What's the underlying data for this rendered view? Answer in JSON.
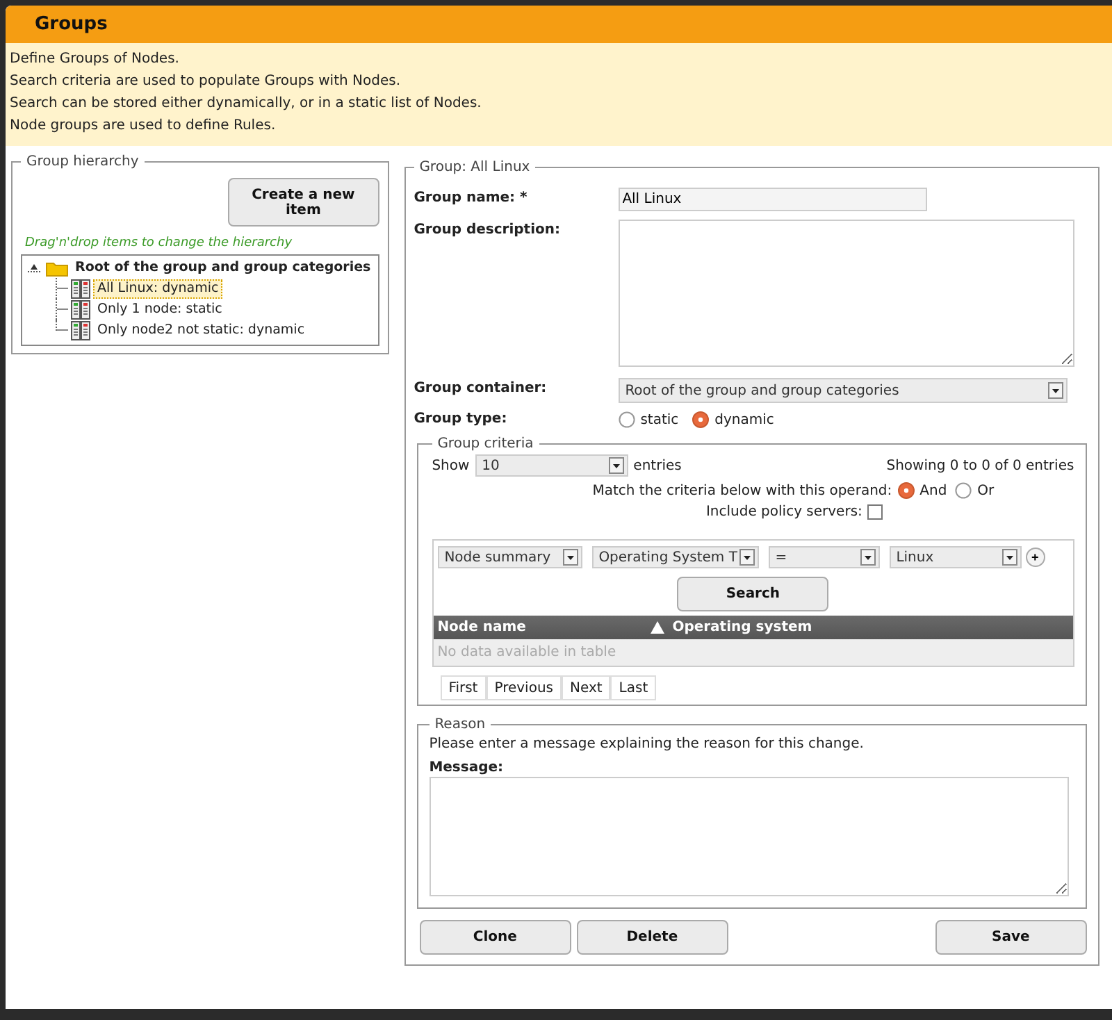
{
  "header": {
    "title": "Groups"
  },
  "description": [
    "Define Groups of Nodes.",
    "Search criteria are used to populate Groups with Nodes.",
    "Search can be stored either dynamically, or in a static list of Nodes.",
    "Node groups are used to define Rules."
  ],
  "hierarchy": {
    "legend": "Group hierarchy",
    "create_button": "Create a new item",
    "hint": "Drag'n'drop items to change the hierarchy",
    "tree": [
      {
        "label": "Root of the group and group categories",
        "kind": "category",
        "expanded": true,
        "selected": false,
        "children": [
          {
            "label": "All Linux: dynamic",
            "kind": "group",
            "selected": true
          },
          {
            "label": "Only 1 node: static",
            "kind": "group",
            "selected": false
          },
          {
            "label": "Only node2 not static: dynamic",
            "kind": "group",
            "selected": false
          }
        ]
      }
    ]
  },
  "group_form": {
    "legend": "Group: All Linux",
    "fields": [
      {
        "label": "Group name: *",
        "kind": "text",
        "value": "All Linux"
      },
      {
        "label": "Group description:",
        "kind": "textarea"
      },
      {
        "label": "Group container:",
        "kind": "select",
        "value": "Root of the group and group categories"
      },
      {
        "label": "Group type:",
        "kind": "radio",
        "options": [
          {
            "label": "static",
            "selected": false
          },
          {
            "label": "dynamic",
            "selected": true
          }
        ]
      }
    ],
    "criteria": {
      "legend": "Group criteria",
      "show_label": "Show",
      "page_size": "10",
      "entries_label": "entries",
      "info": "Showing 0 to 0 of 0 entries",
      "operand_label": "Match the criteria below with this operand:",
      "operands": [
        {
          "label": "And",
          "selected": true
        },
        {
          "label": "Or",
          "selected": false
        }
      ],
      "include_label": "Include policy servers:",
      "include_checked": false,
      "criterion": [
        "Node summary",
        "Operating System T",
        "=",
        "Linux"
      ],
      "add_button": "+",
      "search_button": "Search",
      "columns": [
        {
          "label": "Node name",
          "sorted": false
        },
        {
          "label": "Operating system",
          "sorted": true
        }
      ],
      "empty": "No data available in table",
      "pagination": [
        "First",
        "Previous",
        "Next",
        "Last"
      ]
    },
    "reason": {
      "legend": "Reason",
      "prompt": "Please enter a message explaining the reason for this change.",
      "message_label": "Message:"
    },
    "buttons": [
      {
        "label": "Clone",
        "kind": "left"
      },
      {
        "label": "Delete",
        "kind": "left"
      },
      {
        "label": "Save",
        "kind": "right"
      }
    ]
  }
}
